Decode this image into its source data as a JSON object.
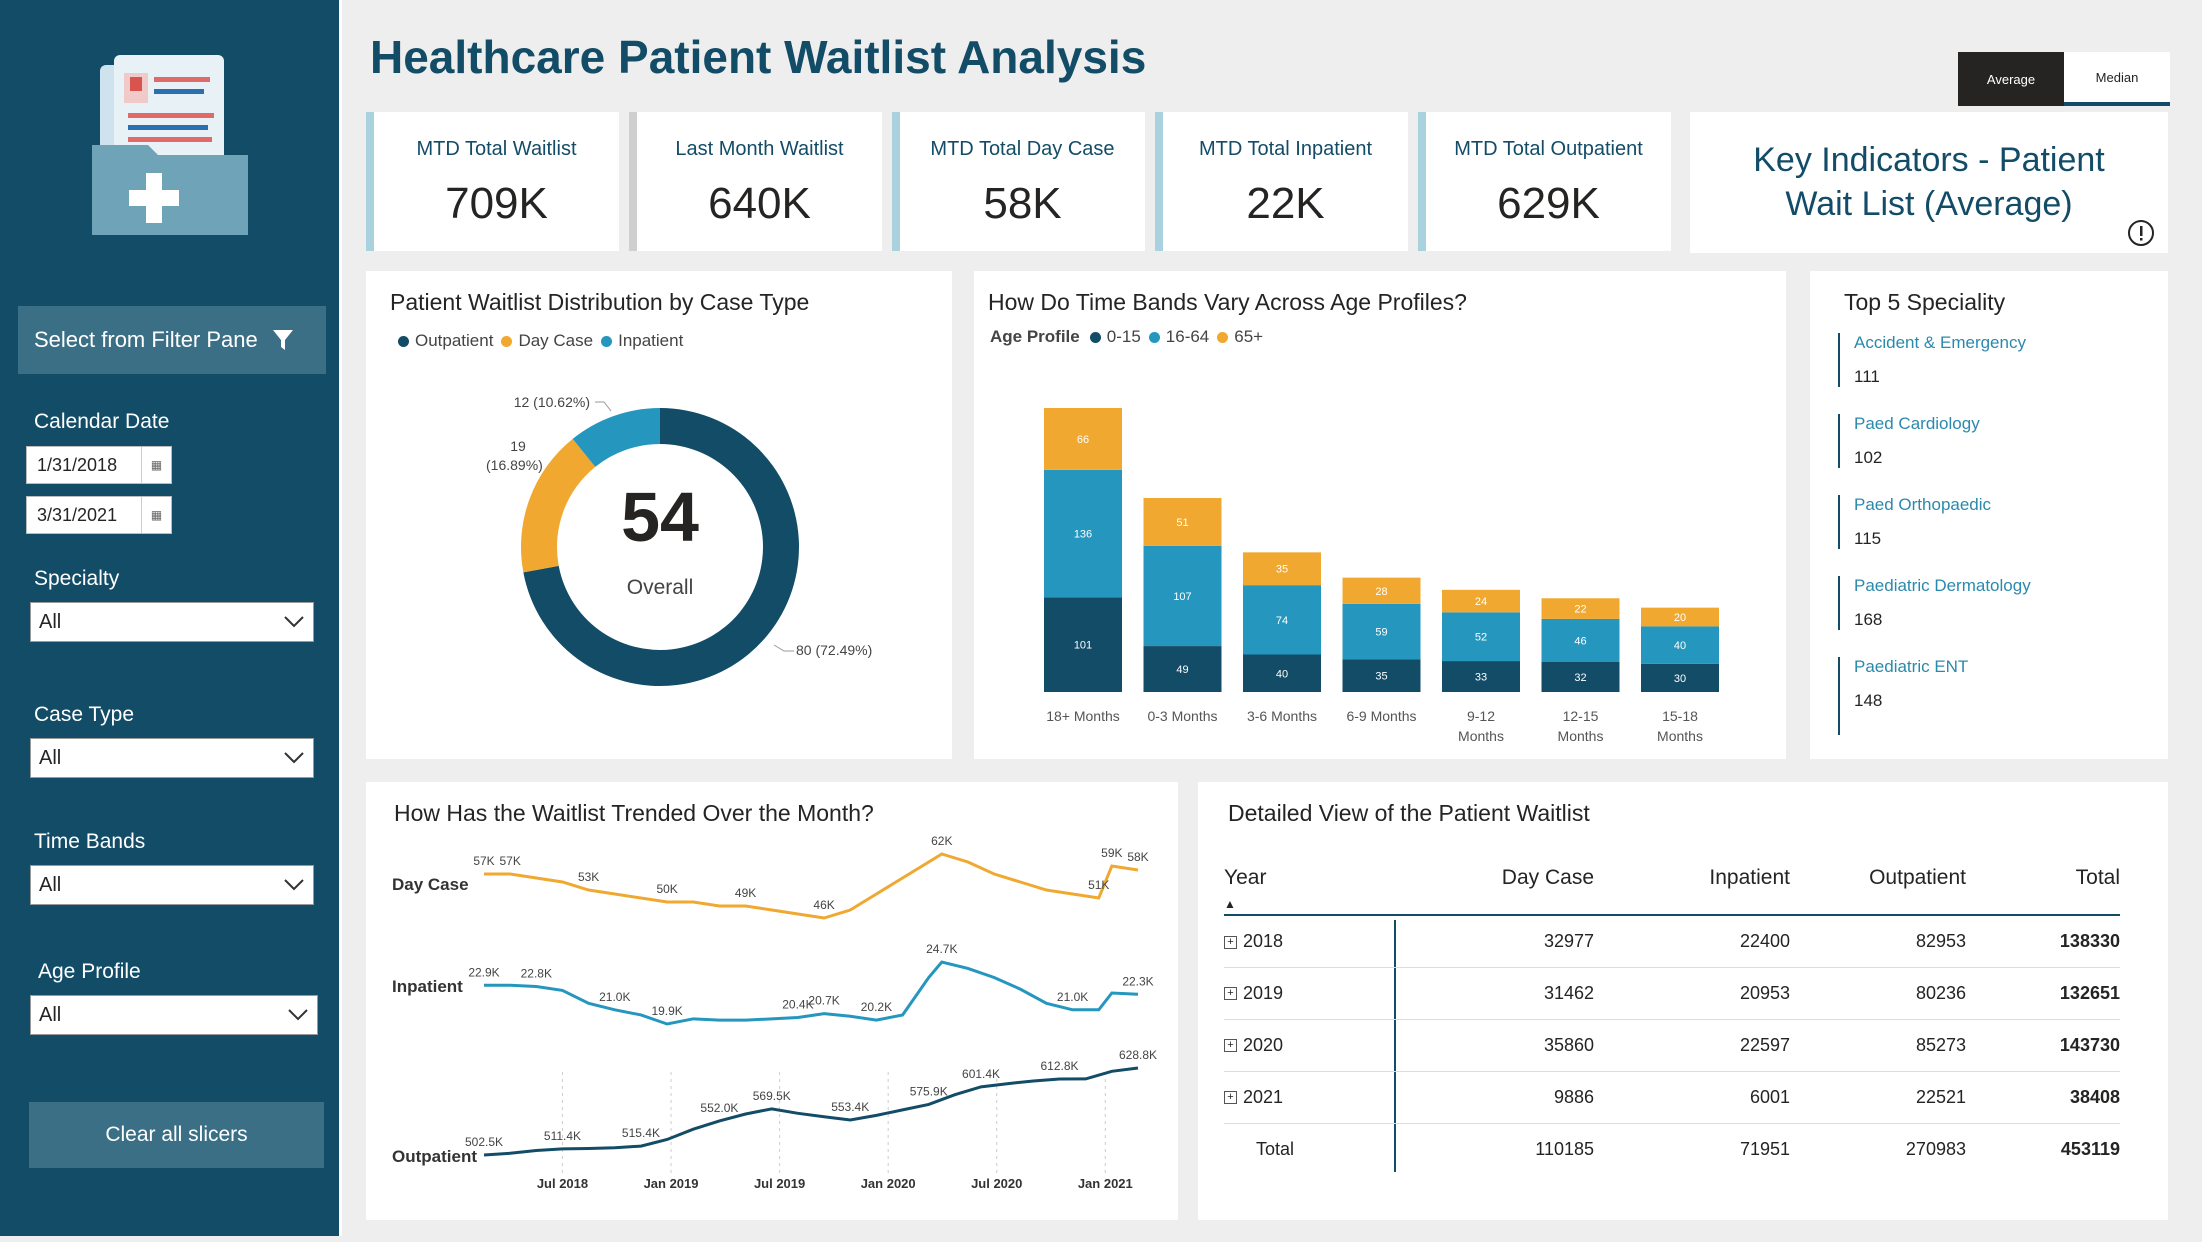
{
  "page": {
    "title": "Healthcare Patient Waitlist Analysis"
  },
  "toggle": {
    "average": "Average",
    "median": "Median"
  },
  "sidebar": {
    "filter_button": "Select from Filter Pane",
    "calendar_label": "Calendar Date",
    "date_start": "1/31/2018",
    "date_end": "3/31/2021",
    "specialty_label": "Specialty",
    "specialty_value": "All",
    "case_type_label": "Case Type",
    "case_type_value": "All",
    "time_bands_label": "Time Bands",
    "time_bands_value": "All",
    "age_profile_label": "Age Profile",
    "age_profile_value": "All",
    "clear_button": "Clear all slicers"
  },
  "kpis": [
    {
      "label": "MTD Total Waitlist",
      "value": "709K"
    },
    {
      "label": "Last Month Waitlist",
      "value": "640K"
    },
    {
      "label": "MTD Total Day Case",
      "value": "58K"
    },
    {
      "label": "MTD Total Inpatient",
      "value": "22K"
    },
    {
      "label": "MTD Total Outpatient",
      "value": "629K"
    }
  ],
  "key_indicators": {
    "line1": "Key Indicators - Patient",
    "line2": "Wait List (Average)"
  },
  "colors": {
    "outpatient": "#124c67",
    "day_case": "#f0a830",
    "inpatient": "#2596be",
    "brand": "#124c67"
  },
  "donut": {
    "title": "Patient Waitlist Distribution by Case Type",
    "center_value": "54",
    "center_label": "Overall",
    "legend": [
      "Outpatient",
      "Day Case",
      "Inpatient"
    ],
    "label_inpatient": "12 (10.62%)",
    "label_daycase_1": "19",
    "label_daycase_2": "(16.89%)",
    "label_outpatient": "80 (72.49%)"
  },
  "bars": {
    "title": "How Do Time Bands Vary Across Age Profiles?",
    "legend_title": "Age Profile",
    "legend": [
      "0-15",
      "16-64",
      "65+"
    ]
  },
  "specialities": {
    "title": "Top 5 Speciality",
    "items": [
      {
        "name": "Accident & Emergency",
        "value": "111"
      },
      {
        "name": "Paed Cardiology",
        "value": "102"
      },
      {
        "name": "Paed Orthopaedic",
        "value": "115"
      },
      {
        "name": "Paediatric Dermatology",
        "value": "168"
      },
      {
        "name": "Paediatric ENT",
        "value": "148"
      }
    ]
  },
  "trend": {
    "title": "How Has the Waitlist Trended Over the Month?",
    "row_labels": [
      "Day Case",
      "Inpatient",
      "Outpatient"
    ]
  },
  "detail": {
    "title": "Detailed View of the Patient Waitlist",
    "headers": [
      "Year",
      "Day Case",
      "Inpatient",
      "Outpatient",
      "Total"
    ],
    "rows": [
      {
        "year": "2018",
        "day_case": "32977",
        "inpatient": "22400",
        "outpatient": "82953",
        "total": "138330"
      },
      {
        "year": "2019",
        "day_case": "31462",
        "inpatient": "20953",
        "outpatient": "80236",
        "total": "132651"
      },
      {
        "year": "2020",
        "day_case": "35860",
        "inpatient": "22597",
        "outpatient": "85273",
        "total": "143730"
      },
      {
        "year": "2021",
        "day_case": "9886",
        "inpatient": "6001",
        "outpatient": "22521",
        "total": "38408"
      }
    ],
    "total_row": {
      "label": "Total",
      "day_case": "110185",
      "inpatient": "71951",
      "outpatient": "270983",
      "total": "453119"
    }
  },
  "chart_data": [
    {
      "type": "pie",
      "title": "Patient Waitlist Distribution by Case Type",
      "categories": [
        "Outpatient",
        "Day Case",
        "Inpatient"
      ],
      "values": [
        80,
        19,
        12
      ],
      "percent": [
        72.49,
        16.89,
        10.62
      ],
      "center": "54"
    },
    {
      "type": "bar",
      "stacked": true,
      "title": "How Do Time Bands Vary Across Age Profiles?",
      "categories": [
        "18+ Months",
        "0-3 Months",
        "3-6 Months",
        "6-9 Months",
        "9-12 Months",
        "12-15 Months",
        "15-18 Months"
      ],
      "series": [
        {
          "name": "0-15",
          "values": [
            101,
            49,
            40,
            35,
            33,
            32,
            30
          ]
        },
        {
          "name": "16-64",
          "values": [
            136,
            107,
            74,
            59,
            52,
            46,
            40
          ]
        },
        {
          "name": "65+",
          "values": [
            66,
            51,
            35,
            28,
            24,
            22,
            20
          ]
        }
      ]
    },
    {
      "type": "line",
      "title": "How Has the Waitlist Trended Over the Month?",
      "x_ticks": [
        "Jul 2018",
        "Jan 2019",
        "Jul 2019",
        "Jan 2020",
        "Jul 2020",
        "Jan 2021"
      ],
      "series": [
        {
          "name": "Day Case",
          "points": [
            [
              0,
              57
            ],
            [
              2,
              57
            ],
            [
              4,
              56
            ],
            [
              6,
              55
            ],
            [
              8,
              53
            ],
            [
              10,
              52
            ],
            [
              12,
              51
            ],
            [
              14,
              50
            ],
            [
              16,
              50
            ],
            [
              18,
              49
            ],
            [
              20,
              49
            ],
            [
              22,
              48
            ],
            [
              24,
              47
            ],
            [
              26,
              46
            ],
            [
              28,
              48
            ],
            [
              30,
              52
            ],
            [
              32,
              56
            ],
            [
              34,
              60
            ],
            [
              35,
              62
            ],
            [
              37,
              60
            ],
            [
              39,
              57
            ],
            [
              41,
              55
            ],
            [
              43,
              53
            ],
            [
              45,
              52
            ],
            [
              47,
              51
            ],
            [
              48,
              59
            ],
            [
              50,
              58
            ]
          ],
          "labels": [
            [
              0,
              "57K"
            ],
            [
              2,
              "57K"
            ],
            [
              8,
              "53K"
            ],
            [
              14,
              "50K"
            ],
            [
              20,
              "49K"
            ],
            [
              26,
              "46K"
            ],
            [
              35,
              "62K"
            ],
            [
              47,
              "51K"
            ],
            [
              48,
              "59K"
            ],
            [
              50,
              "58K"
            ]
          ]
        },
        {
          "name": "Inpatient",
          "points": [
            [
              0,
              22.9
            ],
            [
              2,
              22.9
            ],
            [
              4,
              22.8
            ],
            [
              6,
              22.5
            ],
            [
              8,
              21.5
            ],
            [
              10,
              21.0
            ],
            [
              12,
              20.6
            ],
            [
              14,
              19.9
            ],
            [
              16,
              20.3
            ],
            [
              18,
              20.2
            ],
            [
              20,
              20.2
            ],
            [
              22,
              20.3
            ],
            [
              24,
              20.4
            ],
            [
              26,
              20.7
            ],
            [
              28,
              20.5
            ],
            [
              30,
              20.2
            ],
            [
              32,
              20.6
            ],
            [
              34,
              23.5
            ],
            [
              35,
              24.7
            ],
            [
              37,
              24.2
            ],
            [
              39,
              23.5
            ],
            [
              41,
              22.6
            ],
            [
              43,
              21.5
            ],
            [
              45,
              21.0
            ],
            [
              47,
              21.0
            ],
            [
              48,
              22.3
            ],
            [
              50,
              22.2
            ]
          ],
          "labels": [
            [
              0,
              "22.9K"
            ],
            [
              4,
              "22.8K"
            ],
            [
              10,
              "21.0K"
            ],
            [
              14,
              "19.9K"
            ],
            [
              24,
              "20.4K"
            ],
            [
              26,
              "20.7K"
            ],
            [
              30,
              "20.2K"
            ],
            [
              35,
              "24.7K"
            ],
            [
              45,
              "21.0K"
            ],
            [
              50,
              "22.3K"
            ]
          ]
        },
        {
          "name": "Outpatient",
          "points": [
            [
              0,
              502.5
            ],
            [
              2,
              505
            ],
            [
              4,
              509
            ],
            [
              6,
              511.4
            ],
            [
              8,
              512
            ],
            [
              10,
              513
            ],
            [
              12,
              515.4
            ],
            [
              14,
              525
            ],
            [
              16,
              540
            ],
            [
              18,
              552
            ],
            [
              20,
              562
            ],
            [
              22,
              569.5
            ],
            [
              24,
              563
            ],
            [
              26,
              558
            ],
            [
              28,
              553.4
            ],
            [
              30,
              560
            ],
            [
              32,
              568
            ],
            [
              34,
              575.9
            ],
            [
              36,
              590
            ],
            [
              38,
              601.4
            ],
            [
              40,
              606
            ],
            [
              42,
              610
            ],
            [
              44,
              612.8
            ],
            [
              46,
              613
            ],
            [
              48,
              624
            ],
            [
              50,
              628.8
            ]
          ],
          "labels": [
            [
              0,
              "502.5K"
            ],
            [
              6,
              "511.4K"
            ],
            [
              12,
              "515.4K"
            ],
            [
              18,
              "552.0K"
            ],
            [
              22,
              "569.5K"
            ],
            [
              28,
              "553.4K"
            ],
            [
              34,
              "575.9K"
            ],
            [
              38,
              "601.4K"
            ],
            [
              44,
              "612.8K"
            ],
            [
              50,
              "628.8K"
            ]
          ]
        }
      ]
    }
  ]
}
